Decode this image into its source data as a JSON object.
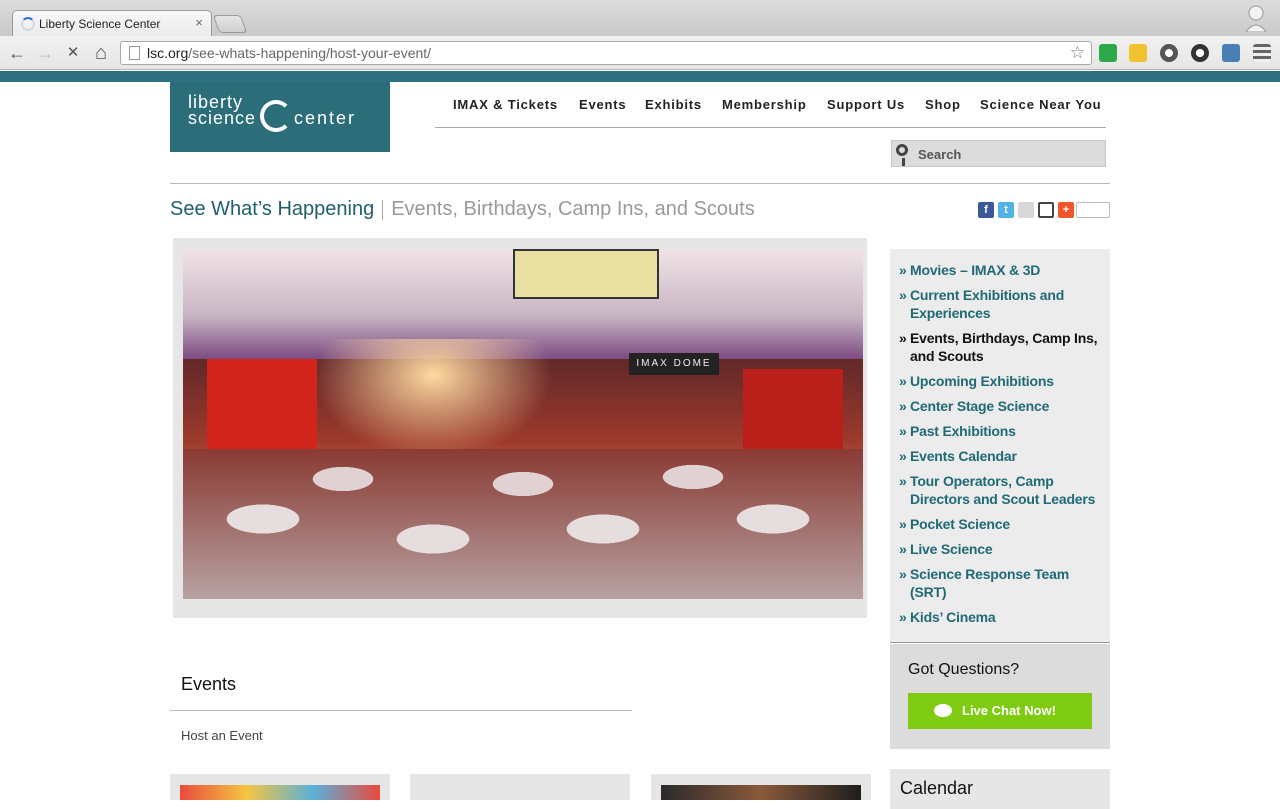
{
  "browser": {
    "tab_title": "Liberty Science Center",
    "tab_close": "×",
    "url_host": "lsc.org",
    "url_path": "/see-whats-happening/host-your-event/",
    "back": "←",
    "forward": "→",
    "stop": "✕",
    "home": "⌂",
    "star": "☆"
  },
  "logo": {
    "line1": "liberty",
    "line2": "science",
    "line3": "center"
  },
  "nav": {
    "items": [
      "IMAX & Tickets",
      "Events",
      "Exhibits",
      "Membership",
      "Support Us",
      "Shop",
      "Science Near You"
    ]
  },
  "search": {
    "placeholder": "Search"
  },
  "heading": {
    "main": "See What’s Happening",
    "sub": "Events, Birthdays, Camp Ins, and Scouts"
  },
  "hero": {
    "sign": "IMAX DOME"
  },
  "events": {
    "title": "Events",
    "link": "Host an Event"
  },
  "sidebar": {
    "bullet": "»",
    "items": [
      {
        "label": "Movies – IMAX & 3D"
      },
      {
        "label": "Current Exhibitions and Experiences"
      },
      {
        "label": "Events, Birthdays, Camp Ins, and Scouts",
        "active": true
      },
      {
        "label": "Upcoming Exhibitions"
      },
      {
        "label": "Center Stage Science"
      },
      {
        "label": "Past Exhibitions"
      },
      {
        "label": "Events Calendar"
      },
      {
        "label": "Tour Operators, Camp Directors and Scout Leaders"
      },
      {
        "label": "Pocket Science"
      },
      {
        "label": "Live Science"
      },
      {
        "label": "Science Response Team (SRT)"
      },
      {
        "label": "Kids’ Cinema"
      }
    ]
  },
  "questions": {
    "title": "Got Questions?",
    "button": "Live Chat Now!"
  },
  "calendar": {
    "title": "Calendar"
  },
  "colors": {
    "teal": "#2b6e7a",
    "link": "#1f6a76",
    "chat_green": "#7fcb11"
  }
}
